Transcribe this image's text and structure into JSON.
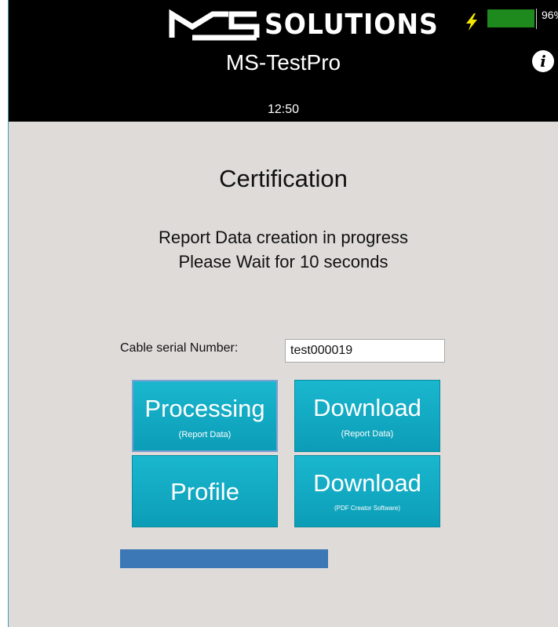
{
  "header": {
    "brand": "SOLUTIONS",
    "app_name": "MS-TestPro",
    "time": "12:50",
    "battery_percent_text": "96%",
    "battery_level": 0.96,
    "colors": {
      "background": "#000000",
      "battery": "#1e8a1e",
      "bolt": "#f2e600"
    }
  },
  "main": {
    "title": "Certification",
    "status_line1": "Report Data creation in progress",
    "status_line2": "Please Wait for 10 seconds",
    "serial_label": "Cable serial Number:",
    "serial_value": "test000019"
  },
  "buttons": {
    "processing": {
      "label": "Processing",
      "sub": "(Report Data)"
    },
    "download_report": {
      "label": "Download",
      "sub": "(Report Data)"
    },
    "profile": {
      "label": "Profile"
    },
    "download_pdf": {
      "label": "Download",
      "sub": "(PDF Creator Software)"
    }
  },
  "colors": {
    "tile": "#12acc5",
    "progress": "#3b78b5",
    "page_bg": "#dedbd9"
  },
  "icons": [
    "ms-logo-icon",
    "lightning-bolt-icon",
    "info-icon"
  ]
}
